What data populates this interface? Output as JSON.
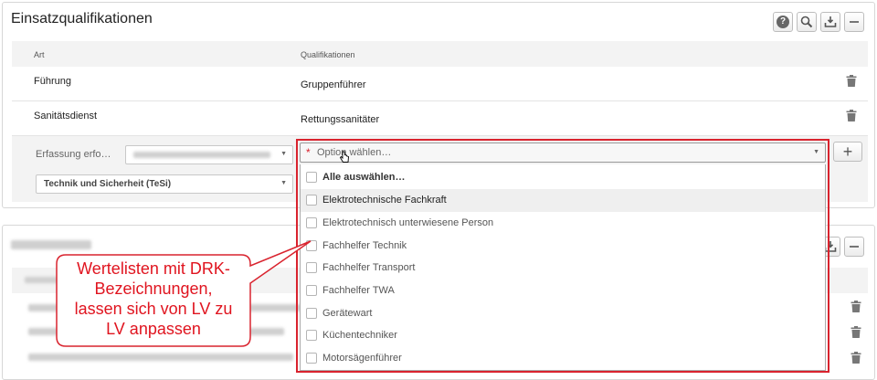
{
  "panel": {
    "title": "Einsatzqualifikationen",
    "toolbar": {
      "help_icon": "help-icon",
      "search_icon": "search-icon",
      "export_icon": "download-tray-icon",
      "collapse_icon": "minus-icon"
    }
  },
  "table": {
    "columns": [
      "Art",
      "Qualifikationen"
    ],
    "rows": [
      {
        "art": "Führung",
        "qualifikation": "Gruppenführer"
      },
      {
        "art": "Sanitätsdienst",
        "qualifikation": "Rettungssanitäter"
      }
    ]
  },
  "edit_row": {
    "label": "Erfassung erfo…",
    "category_select": "Technik und Sicherheit (TeSi)",
    "qual_placeholder": "Option wählen…",
    "required_marker": "*"
  },
  "dropdown": {
    "select_all": "Alle auswählen…",
    "options": [
      "Elektrotechnische Fachkraft",
      "Elektrotechnisch unterwiesene Person",
      "Fachhelfer Technik",
      "Fachhelfer Transport",
      "Fachhelfer TWA",
      "Gerätewart",
      "Küchentechniker",
      "Motorsägenführer"
    ]
  },
  "callout": {
    "lines": [
      "Wertelisten mit DRK-",
      "Bezeichnungen,",
      "lassen sich von LV zu",
      "LV anpassen"
    ],
    "color": "#e0141f"
  },
  "colors": {
    "accent_red": "#d9232e",
    "header_bg": "#f3f3f3"
  }
}
